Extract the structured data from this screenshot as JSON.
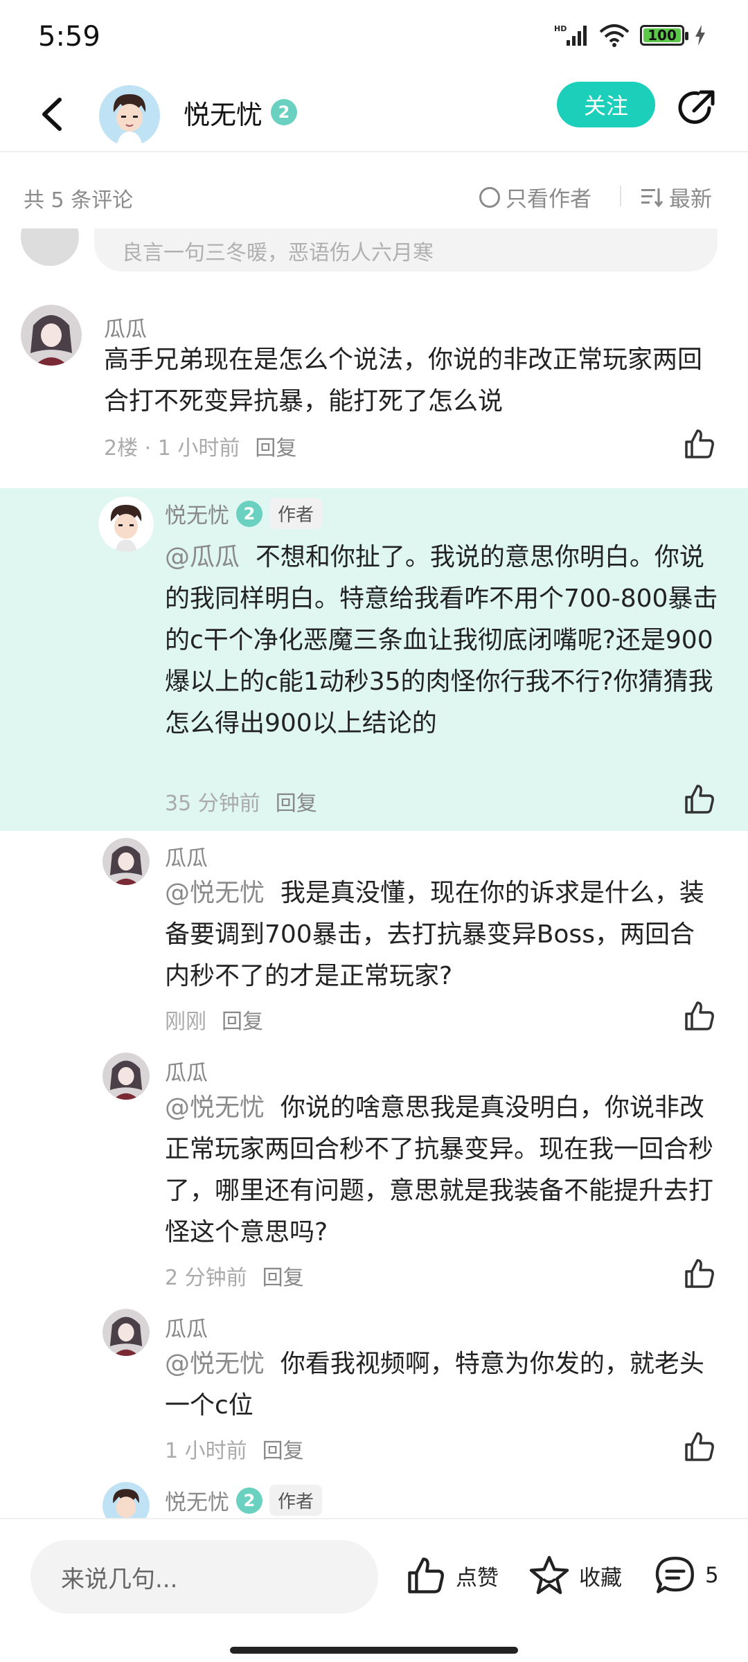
{
  "status_bar": {
    "time": "5:59",
    "signal_label": "HD",
    "battery": "100"
  },
  "header": {
    "username": "悦无忧",
    "level": "2",
    "follow_label": "关注"
  },
  "filter_bar": {
    "count_label": "共 5 条评论",
    "only_author_label": "只看作者",
    "sort_label": "最新"
  },
  "previous_comment_preview": "良言一句三冬暖，恶语伤人六月寒",
  "comments": [
    {
      "user": "瓜瓜",
      "text": "高手兄弟现在是怎么个说法，你说的非改正常玩家两回合打不死变异抗暴，能打死了怎么说",
      "meta": "2楼 · 1 小时前",
      "reply_label": "回复"
    },
    {
      "user": "悦无忧",
      "level": "2",
      "tag": "作者",
      "mention": "@瓜瓜",
      "text": "不想和你扯了。我说的意思你明白。你说的我同样明白。特意给我看咋不用个700-800暴击的c干个净化恶魔三条血让我彻底闭嘴呢?还是900爆以上的c能1动秒35的肉怪你行我不行?你猜猜我怎么得出900以上结论的",
      "meta": "35 分钟前",
      "reply_label": "回复"
    },
    {
      "user": "瓜瓜",
      "mention": "@悦无忧",
      "text": "我是真没懂，现在你的诉求是什么，装备要调到700暴击，去打抗暴变异Boss，两回合内秒不了的才是正常玩家?",
      "meta": "刚刚",
      "reply_label": "回复"
    },
    {
      "user": "瓜瓜",
      "mention": "@悦无忧",
      "text": "你说的啥意思我是真没明白，你说非改正常玩家两回合秒不了抗暴变异。现在我一回合秒了，哪里还有问题，意思就是我装备不能提升去打怪这个意思吗?",
      "meta": "2 分钟前",
      "reply_label": "回复"
    },
    {
      "user": "瓜瓜",
      "mention": "@悦无忧",
      "text": "你看我视频啊，特意为你发的，就老头一个c位",
      "meta": "1 小时前",
      "reply_label": "回复"
    },
    {
      "user": "悦无忧",
      "level": "2",
      "tag": "作者"
    }
  ],
  "bottom_bar": {
    "input_placeholder": "来说几句...",
    "like_label": "点赞",
    "collect_label": "收藏",
    "comment_count": "5"
  },
  "colors": {
    "accent": "#1ccfba",
    "highlight": "#dff6f1",
    "level_badge": "#6ad1c0"
  }
}
